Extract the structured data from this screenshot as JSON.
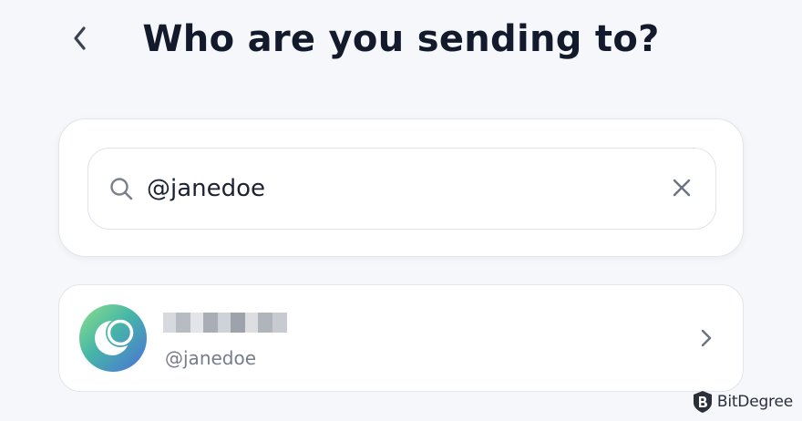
{
  "header": {
    "title": "Who are you sending to?",
    "back_icon": "chevron-left-icon"
  },
  "search": {
    "value": "@janedoe",
    "search_icon": "search-icon",
    "clear_icon": "close-icon"
  },
  "results": [
    {
      "display_name": "",
      "display_name_redacted": true,
      "handle": "@janedoe",
      "avatar_icon": "moon-avatar-icon",
      "chevron_icon": "chevron-right-icon"
    }
  ],
  "watermark": {
    "text": "BitDegree"
  },
  "colors": {
    "background": "#f5f7fa",
    "title": "#131a2c",
    "card": "#ffffff",
    "border": "#e2e6ec",
    "secondary_text": "#767d8c",
    "icon": "#6b7280"
  }
}
